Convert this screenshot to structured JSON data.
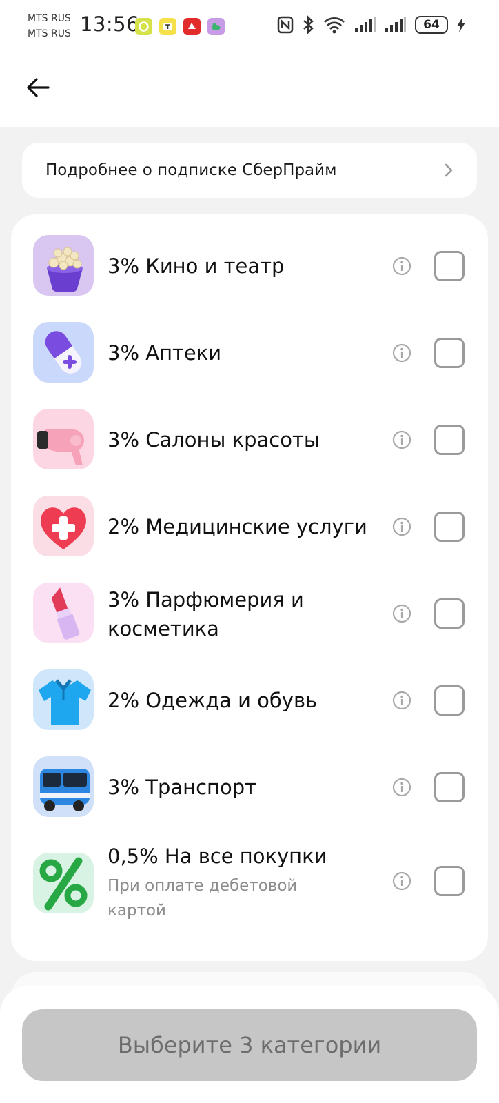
{
  "status_bar": {
    "carrier_1": "MTS RUS",
    "carrier_2": "MTS RUS",
    "time": "13:56",
    "battery": "64"
  },
  "header": {
    "back_icon": "arrow-left-icon"
  },
  "link_card": {
    "label": "Подробнее о подписке СберПрайм",
    "icon": "chevron-right-icon"
  },
  "categories": [
    {
      "title": "3% Кино и театр",
      "subtitle": "",
      "icon": "popcorn-icon"
    },
    {
      "title": "3% Аптеки",
      "subtitle": "",
      "icon": "pill-icon"
    },
    {
      "title": "3% Салоны красоты",
      "subtitle": "",
      "icon": "hair-dryer-icon"
    },
    {
      "title": "2% Медицинские услуги",
      "subtitle": "",
      "icon": "medical-heart-icon"
    },
    {
      "title": "3% Парфюмерия и косметика",
      "subtitle": "",
      "icon": "lipstick-icon"
    },
    {
      "title": "2% Одежда и обувь",
      "subtitle": "",
      "icon": "polo-shirt-icon"
    },
    {
      "title": "3% Транспорт",
      "subtitle": "",
      "icon": "bus-icon"
    },
    {
      "title": "0,5% На все покупки",
      "subtitle": "При оплате дебетовой картой",
      "icon": "percent-icon"
    }
  ],
  "cta": {
    "label": "Выберите 3 категории"
  },
  "colors": {
    "background": "#f2f2f2",
    "card": "#ffffff",
    "cta_disabled": "#c6c6c6",
    "cta_text": "#6d6d6d"
  }
}
